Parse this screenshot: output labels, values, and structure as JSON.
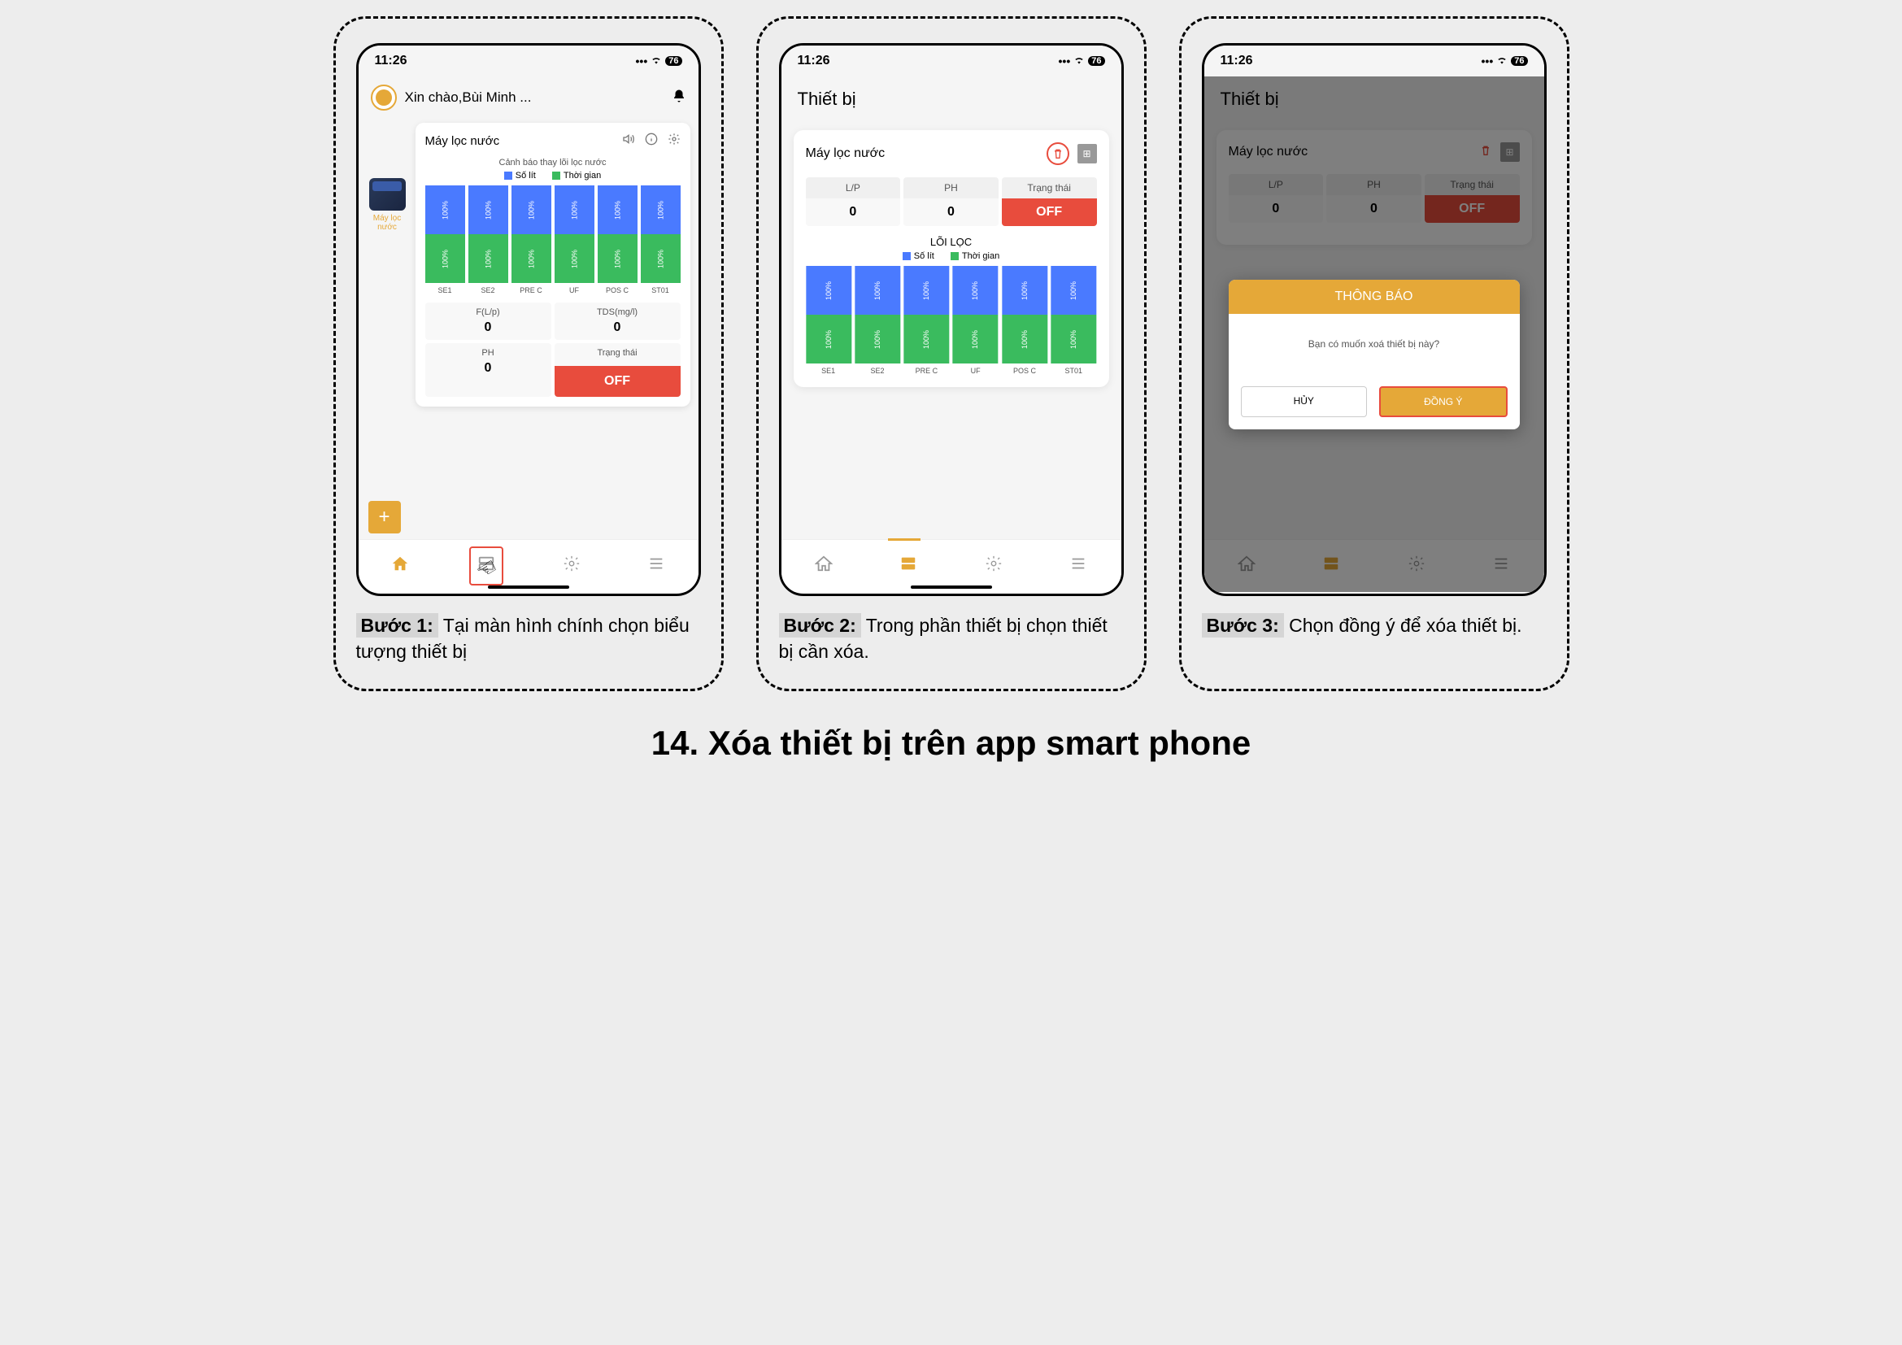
{
  "title": "14. Xóa thiết bị trên app smart phone",
  "status": {
    "time": "11:26",
    "battery": "76"
  },
  "step1": {
    "label": "Bước 1:",
    "text": " Tại màn hình chính chọn biểu tượng thiết bị",
    "greeting": "Xin chào,Bùi Minh ...",
    "side_label": "Máy lọc nước",
    "card_title": "Máy lọc nước",
    "warning": "Cảnh báo thay lõi lọc nước",
    "legend_liters": "Số lít",
    "legend_time": "Thời gian",
    "bars": [
      {
        "label": "SE1",
        "b": "100%",
        "g": "100%"
      },
      {
        "label": "SE2",
        "b": "100%",
        "g": "100%"
      },
      {
        "label": "PRE C",
        "b": "100%",
        "g": "100%"
      },
      {
        "label": "UF",
        "b": "100%",
        "g": "100%"
      },
      {
        "label": "POS C",
        "b": "100%",
        "g": "100%"
      },
      {
        "label": "ST01",
        "b": "100%",
        "g": "100%"
      }
    ],
    "stats": {
      "flp_label": "F(L/p)",
      "flp_val": "0",
      "tds_label": "TDS(mg/l)",
      "tds_val": "0",
      "ph_label": "PH",
      "ph_val": "0",
      "status_label": "Trạng thái",
      "status_val": "OFF"
    }
  },
  "step2": {
    "label": "Bước 2:",
    "text": " Trong phần thiết bị chọn thiết bị cần xóa.",
    "page_title": "Thiết bị",
    "card_title": "Máy lọc nước",
    "row": {
      "lp": "L/P",
      "lp_v": "0",
      "ph": "PH",
      "ph_v": "0",
      "st": "Trạng thái",
      "st_v": "OFF"
    },
    "loiloc": "LÕI LỌC",
    "legend_liters": "Số lít",
    "legend_time": "Thời gian",
    "bars": [
      {
        "label": "SE1",
        "b": "100%",
        "g": "100%"
      },
      {
        "label": "SE2",
        "b": "100%",
        "g": "100%"
      },
      {
        "label": "PRE C",
        "b": "100%",
        "g": "100%"
      },
      {
        "label": "UF",
        "b": "100%",
        "g": "100%"
      },
      {
        "label": "POS C",
        "b": "100%",
        "g": "100%"
      },
      {
        "label": "ST01",
        "b": "100%",
        "g": "100%"
      }
    ]
  },
  "step3": {
    "label": "Bước 3:",
    "text": " Chọn đồng ý để xóa thiết bị.",
    "page_title": "Thiết bị",
    "card_title": "Máy lọc nước",
    "row": {
      "lp": "L/P",
      "lp_v": "0",
      "ph": "PH",
      "ph_v": "0",
      "st": "Trạng thái",
      "st_v": "OFF"
    },
    "modal": {
      "title": "THÔNG BÁO",
      "body": "Bạn có muốn xoá thiết bị này?",
      "cancel": "HỦY",
      "ok": "ĐỒNG Ý"
    }
  },
  "chart_data": {
    "type": "bar",
    "note": "Dual-segment filter-life bars per filter; all at 100%",
    "categories": [
      "SE1",
      "SE2",
      "PRE C",
      "UF",
      "POS C",
      "ST01"
    ],
    "series": [
      {
        "name": "Số lít",
        "values": [
          100,
          100,
          100,
          100,
          100,
          100
        ],
        "unit": "%",
        "color": "#4a7aff"
      },
      {
        "name": "Thời gian",
        "values": [
          100,
          100,
          100,
          100,
          100,
          100
        ],
        "unit": "%",
        "color": "#3abb5e"
      }
    ],
    "title": "Cảnh báo thay lõi lọc nước",
    "ylim": [
      0,
      100
    ]
  }
}
